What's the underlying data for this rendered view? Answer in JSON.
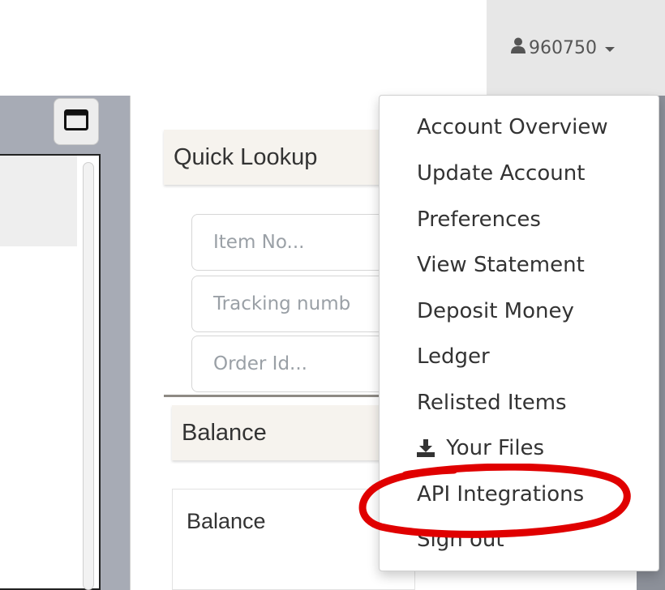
{
  "header": {
    "username": "960750",
    "user_icon": "user-icon",
    "caret_icon": "caret-down-icon"
  },
  "left_panel": {
    "window_icon": "window-maximize-icon"
  },
  "quick_lookup": {
    "title": "Quick Lookup",
    "fields": [
      {
        "placeholder": "Item No..."
      },
      {
        "placeholder": "Tracking numb"
      },
      {
        "placeholder": "Order Id..."
      }
    ]
  },
  "balance": {
    "title": "Balance",
    "label": "Balance"
  },
  "account_menu": {
    "items": [
      {
        "label": "Account Overview"
      },
      {
        "label": "Update Account"
      },
      {
        "label": "Preferences"
      },
      {
        "label": "View Statement"
      },
      {
        "label": "Deposit Money"
      },
      {
        "label": "Ledger"
      },
      {
        "label": "Relisted Items"
      },
      {
        "label": "Your Files",
        "icon": "download-icon"
      },
      {
        "label": "API Integrations"
      },
      {
        "label": "Sign out"
      }
    ]
  },
  "annotation": {
    "color": "#e00000"
  }
}
